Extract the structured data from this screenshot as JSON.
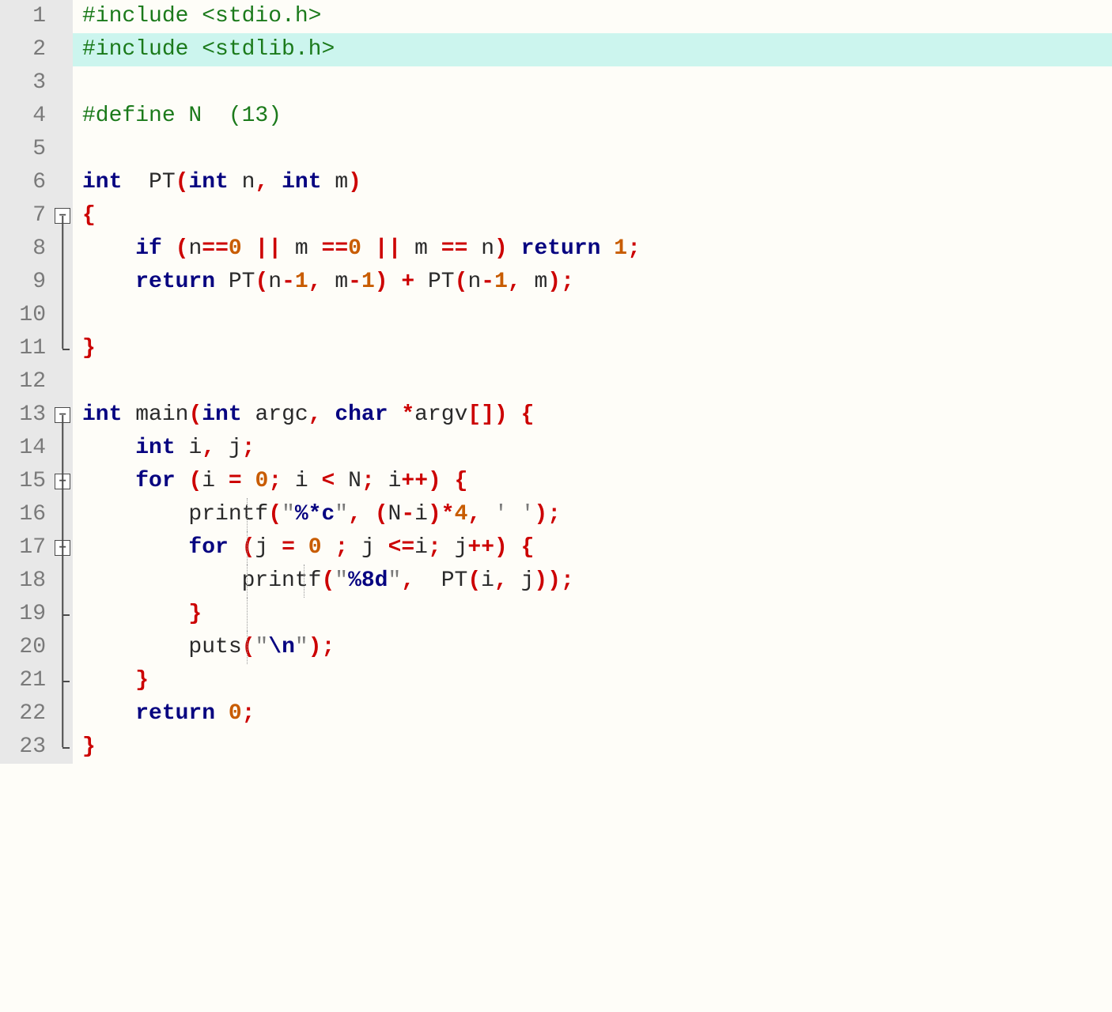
{
  "editor": {
    "highlighted_line": 2,
    "lines": [
      {
        "num": 1,
        "fold": "",
        "tokens": [
          [
            "preproc",
            "#include <stdio.h>"
          ]
        ]
      },
      {
        "num": 2,
        "fold": "",
        "tokens": [
          [
            "preproc",
            "#include <stdlib.h>"
          ]
        ]
      },
      {
        "num": 3,
        "fold": "",
        "tokens": []
      },
      {
        "num": 4,
        "fold": "",
        "tokens": [
          [
            "preproc",
            "#define N  (13)"
          ]
        ]
      },
      {
        "num": 5,
        "fold": "",
        "tokens": []
      },
      {
        "num": 6,
        "fold": "",
        "tokens": [
          [
            "keyword",
            "int"
          ],
          [
            "ident",
            "  PT"
          ],
          [
            "punct",
            "("
          ],
          [
            "keyword",
            "int"
          ],
          [
            "ident",
            " n"
          ],
          [
            "punct",
            ","
          ],
          [
            "ident",
            " "
          ],
          [
            "keyword",
            "int"
          ],
          [
            "ident",
            " m"
          ],
          [
            "punct",
            ")"
          ]
        ]
      },
      {
        "num": 7,
        "fold": "open",
        "tokens": [
          [
            "brace",
            "{"
          ]
        ]
      },
      {
        "num": 8,
        "fold": "mid",
        "tokens": [
          [
            "ident",
            "    "
          ],
          [
            "keyword",
            "if"
          ],
          [
            "ident",
            " "
          ],
          [
            "punct",
            "("
          ],
          [
            "ident",
            "n"
          ],
          [
            "op",
            "=="
          ],
          [
            "num",
            "0"
          ],
          [
            "ident",
            " "
          ],
          [
            "op",
            "||"
          ],
          [
            "ident",
            " m "
          ],
          [
            "op",
            "=="
          ],
          [
            "num",
            "0"
          ],
          [
            "ident",
            " "
          ],
          [
            "op",
            "||"
          ],
          [
            "ident",
            " m "
          ],
          [
            "op",
            "=="
          ],
          [
            "ident",
            " n"
          ],
          [
            "punct",
            ")"
          ],
          [
            "ident",
            " "
          ],
          [
            "keyword",
            "return"
          ],
          [
            "ident",
            " "
          ],
          [
            "num",
            "1"
          ],
          [
            "punct",
            ";"
          ]
        ]
      },
      {
        "num": 9,
        "fold": "mid",
        "tokens": [
          [
            "ident",
            "    "
          ],
          [
            "keyword",
            "return"
          ],
          [
            "ident",
            " PT"
          ],
          [
            "punct",
            "("
          ],
          [
            "ident",
            "n"
          ],
          [
            "op",
            "-"
          ],
          [
            "num",
            "1"
          ],
          [
            "punct",
            ","
          ],
          [
            "ident",
            " m"
          ],
          [
            "op",
            "-"
          ],
          [
            "num",
            "1"
          ],
          [
            "punct",
            ")"
          ],
          [
            "ident",
            " "
          ],
          [
            "op",
            "+"
          ],
          [
            "ident",
            " PT"
          ],
          [
            "punct",
            "("
          ],
          [
            "ident",
            "n"
          ],
          [
            "op",
            "-"
          ],
          [
            "num",
            "1"
          ],
          [
            "punct",
            ","
          ],
          [
            "ident",
            " m"
          ],
          [
            "punct",
            ")"
          ],
          [
            "punct",
            ";"
          ]
        ]
      },
      {
        "num": 10,
        "fold": "mid",
        "tokens": []
      },
      {
        "num": 11,
        "fold": "end",
        "tokens": [
          [
            "brace",
            "}"
          ]
        ]
      },
      {
        "num": 12,
        "fold": "",
        "tokens": []
      },
      {
        "num": 13,
        "fold": "open",
        "tokens": [
          [
            "keyword",
            "int"
          ],
          [
            "ident",
            " main"
          ],
          [
            "punct",
            "("
          ],
          [
            "keyword",
            "int"
          ],
          [
            "ident",
            " argc"
          ],
          [
            "punct",
            ","
          ],
          [
            "ident",
            " "
          ],
          [
            "keyword",
            "char"
          ],
          [
            "ident",
            " "
          ],
          [
            "star",
            "*"
          ],
          [
            "ident",
            "argv"
          ],
          [
            "punct",
            "["
          ],
          [
            "punct",
            "]"
          ],
          [
            "punct",
            ")"
          ],
          [
            "ident",
            " "
          ],
          [
            "brace",
            "{"
          ]
        ]
      },
      {
        "num": 14,
        "fold": "mid",
        "tokens": [
          [
            "ident",
            "    "
          ],
          [
            "keyword",
            "int"
          ],
          [
            "ident",
            " i"
          ],
          [
            "punct",
            ","
          ],
          [
            "ident",
            " j"
          ],
          [
            "punct",
            ";"
          ]
        ]
      },
      {
        "num": 15,
        "fold": "open-mid",
        "tokens": [
          [
            "ident",
            "    "
          ],
          [
            "keyword",
            "for"
          ],
          [
            "ident",
            " "
          ],
          [
            "punct",
            "("
          ],
          [
            "ident",
            "i "
          ],
          [
            "op",
            "="
          ],
          [
            "ident",
            " "
          ],
          [
            "num",
            "0"
          ],
          [
            "punct",
            ";"
          ],
          [
            "ident",
            " i "
          ],
          [
            "op",
            "<"
          ],
          [
            "ident",
            " N"
          ],
          [
            "punct",
            ";"
          ],
          [
            "ident",
            " i"
          ],
          [
            "op",
            "++"
          ],
          [
            "punct",
            ")"
          ],
          [
            "ident",
            " "
          ],
          [
            "brace",
            "{"
          ]
        ]
      },
      {
        "num": 16,
        "fold": "mid",
        "guides": [
          220
        ],
        "tokens": [
          [
            "ident",
            "        printf"
          ],
          [
            "punct",
            "("
          ],
          [
            "str",
            "\""
          ],
          [
            "escape",
            "%*c"
          ],
          [
            "str",
            "\""
          ],
          [
            "punct",
            ","
          ],
          [
            "ident",
            " "
          ],
          [
            "punct",
            "("
          ],
          [
            "ident",
            "N"
          ],
          [
            "op",
            "-"
          ],
          [
            "ident",
            "i"
          ],
          [
            "punct",
            ")"
          ],
          [
            "op",
            "*"
          ],
          [
            "num",
            "4"
          ],
          [
            "punct",
            ","
          ],
          [
            "ident",
            " "
          ],
          [
            "str",
            "' '"
          ],
          [
            "punct",
            ")"
          ],
          [
            "punct",
            ";"
          ]
        ]
      },
      {
        "num": 17,
        "fold": "open-mid",
        "guides": [
          220
        ],
        "tokens": [
          [
            "ident",
            "        "
          ],
          [
            "keyword",
            "for"
          ],
          [
            "ident",
            " "
          ],
          [
            "punct",
            "("
          ],
          [
            "ident",
            "j "
          ],
          [
            "op",
            "="
          ],
          [
            "ident",
            " "
          ],
          [
            "num",
            "0"
          ],
          [
            "ident",
            " "
          ],
          [
            "punct",
            ";"
          ],
          [
            "ident",
            " j "
          ],
          [
            "op",
            "<="
          ],
          [
            "ident",
            "i"
          ],
          [
            "punct",
            ";"
          ],
          [
            "ident",
            " j"
          ],
          [
            "op",
            "++"
          ],
          [
            "punct",
            ")"
          ],
          [
            "ident",
            " "
          ],
          [
            "brace",
            "{"
          ]
        ]
      },
      {
        "num": 18,
        "fold": "mid",
        "guides": [
          220,
          292
        ],
        "tokens": [
          [
            "ident",
            "            printf"
          ],
          [
            "punct",
            "("
          ],
          [
            "str",
            "\""
          ],
          [
            "escape",
            "%8d"
          ],
          [
            "str",
            "\""
          ],
          [
            "punct",
            ","
          ],
          [
            "ident",
            "  PT"
          ],
          [
            "punct",
            "("
          ],
          [
            "ident",
            "i"
          ],
          [
            "punct",
            ","
          ],
          [
            "ident",
            " j"
          ],
          [
            "punct",
            ")"
          ],
          [
            "punct",
            ")"
          ],
          [
            "punct",
            ";"
          ]
        ]
      },
      {
        "num": 19,
        "fold": "mid-tick",
        "guides": [
          220
        ],
        "tokens": [
          [
            "ident",
            "        "
          ],
          [
            "brace",
            "}"
          ]
        ]
      },
      {
        "num": 20,
        "fold": "mid",
        "guides": [
          220
        ],
        "tokens": [
          [
            "ident",
            "        puts"
          ],
          [
            "punct",
            "("
          ],
          [
            "str",
            "\""
          ],
          [
            "escape",
            "\\n"
          ],
          [
            "str",
            "\""
          ],
          [
            "punct",
            ")"
          ],
          [
            "punct",
            ";"
          ]
        ]
      },
      {
        "num": 21,
        "fold": "mid-tick",
        "tokens": [
          [
            "ident",
            "    "
          ],
          [
            "brace",
            "}"
          ]
        ]
      },
      {
        "num": 22,
        "fold": "mid",
        "tokens": [
          [
            "ident",
            "    "
          ],
          [
            "keyword",
            "return"
          ],
          [
            "ident",
            " "
          ],
          [
            "num",
            "0"
          ],
          [
            "punct",
            ";"
          ]
        ]
      },
      {
        "num": 23,
        "fold": "end",
        "tokens": [
          [
            "brace",
            "}"
          ]
        ]
      }
    ]
  }
}
